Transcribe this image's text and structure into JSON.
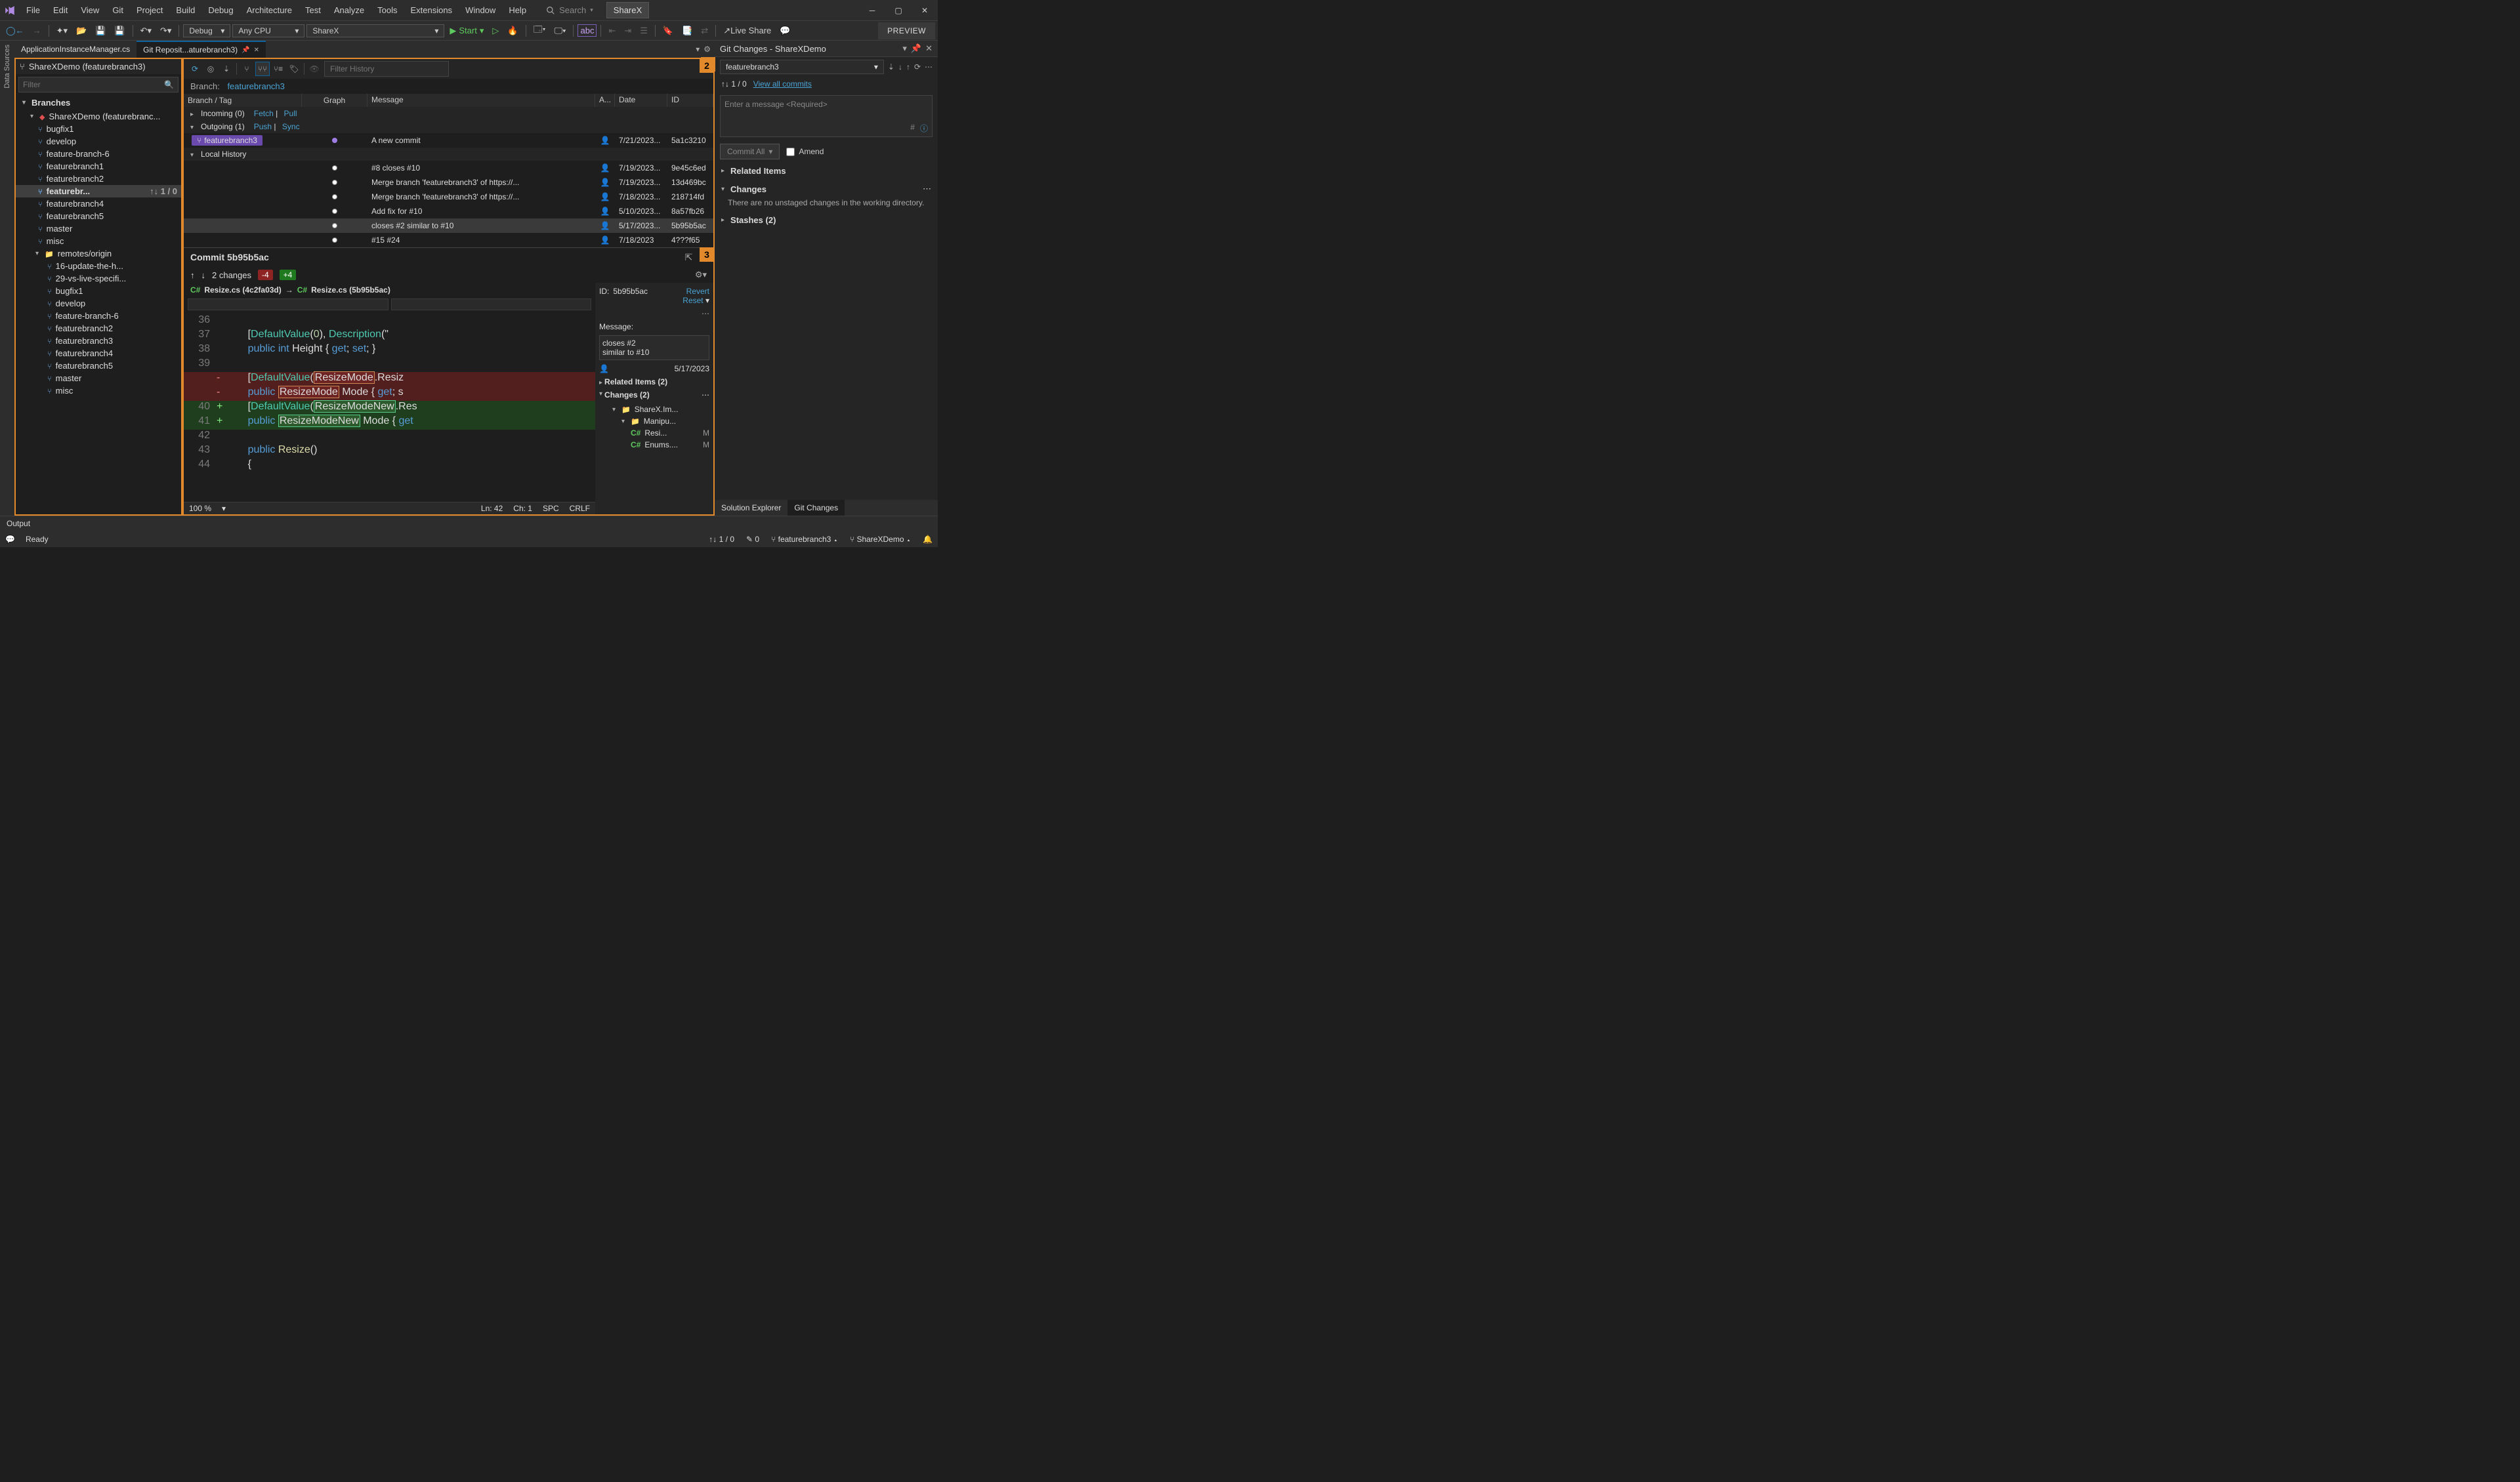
{
  "menu": [
    "File",
    "Edit",
    "View",
    "Git",
    "Project",
    "Build",
    "Debug",
    "Architecture",
    "Test",
    "Analyze",
    "Tools",
    "Extensions",
    "Window",
    "Help"
  ],
  "search_placeholder": "Search",
  "project_name": "ShareX",
  "toolbar": {
    "config": "Debug",
    "platform": "Any CPU",
    "target": "ShareX",
    "start": "Start",
    "live_share": "Live Share",
    "preview": "PREVIEW"
  },
  "tabs": [
    {
      "title": "ApplicationInstanceManager.cs",
      "active": false
    },
    {
      "title": "Git Reposit...aturebranch3)",
      "active": true
    }
  ],
  "repo_panel": {
    "title": "ShareXDemo (featurebranch3)",
    "filter_placeholder": "Filter",
    "branches_label": "Branches",
    "root": "ShareXDemo (featurebranc...",
    "local": [
      "bugfix1",
      "develop",
      "feature-branch-6",
      "featurebranch1",
      "featurebranch2",
      "featurebr...",
      "featurebranch4",
      "featurebranch5",
      "master",
      "misc"
    ],
    "sel_counts": "1 / 0",
    "remotes_label": "remotes/origin",
    "remotes": [
      "16-update-the-h...",
      "29-vs-live-specifi...",
      "bugfix1",
      "develop",
      "feature-branch-6",
      "featurebranch2",
      "featurebranch3",
      "featurebranch4",
      "featurebranch5",
      "master",
      "misc"
    ]
  },
  "history": {
    "filter_placeholder": "Filter History",
    "branch_label": "Branch:",
    "branch_value": "featurebranch3",
    "cols": [
      "Branch / Tag",
      "Graph",
      "Message",
      "A...",
      "Date",
      "ID"
    ],
    "incoming": "Incoming (0)",
    "incoming_actions": [
      "Fetch",
      "Pull"
    ],
    "outgoing": "Outgoing (1)",
    "outgoing_actions": [
      "Push",
      "Sync"
    ],
    "outgoing_commit": {
      "tag": "featurebranch3",
      "msg": "A new commit",
      "date": "7/21/2023...",
      "id": "5a1c3210"
    },
    "local_history_label": "Local History",
    "rows": [
      {
        "msg": "#8 closes #10",
        "date": "7/19/2023...",
        "id": "9e45c6ed"
      },
      {
        "msg": "Merge branch 'featurebranch3' of https://...",
        "date": "7/19/2023...",
        "id": "13d469bc"
      },
      {
        "msg": "Merge branch 'featurebranch3' of https://...",
        "date": "7/18/2023...",
        "id": "218714fd"
      },
      {
        "msg": "Add fix for #10",
        "date": "5/10/2023...",
        "id": "8a57fb26"
      },
      {
        "msg": "closes #2 similar to #10",
        "date": "5/17/2023...",
        "id": "5b95b5ac",
        "sel": true
      },
      {
        "msg": "#15 #24",
        "date": "7/18/2023",
        "id": "4???f65"
      }
    ]
  },
  "commit": {
    "title": "Commit 5b95b5ac",
    "changes_label": "2 changes",
    "minus": "-4",
    "plus": "+4",
    "file_left": "Resize.cs (4c2fa03d)",
    "file_right": "Resize.cs (5b95b5ac)",
    "zoom": "100 %",
    "ln": "Ln: 42",
    "ch": "Ch: 1",
    "spc": "SPC",
    "crlf": "CRLF",
    "side": {
      "id_label": "ID:",
      "id": "5b95b5ac",
      "revert": "Revert",
      "reset": "Reset",
      "msg_label": "Message:",
      "msg": "closes #2\nsimilar to #10",
      "date": "5/17/2023",
      "related": "Related Items (2)",
      "changes": "Changes (2)",
      "folders": [
        "ShareX.Im...",
        "Manipu..."
      ],
      "files": [
        {
          "name": "Resi...",
          "m": "M"
        },
        {
          "name": "Enums....",
          "m": "M"
        }
      ]
    }
  },
  "git_changes": {
    "title": "Git Changes - ShareXDemo",
    "branch": "featurebranch3",
    "counts": "1 / 0",
    "view_all": "View all commits",
    "msg_placeholder": "Enter a message <Required>",
    "commit_all": "Commit All",
    "amend": "Amend",
    "related": "Related Items",
    "changes_label": "Changes",
    "changes_text": "There are no unstaged changes in the working directory.",
    "stashes": "Stashes (2)",
    "tabs": [
      "Solution Explorer",
      "Git Changes"
    ]
  },
  "output_label": "Output",
  "status": {
    "ready": "Ready",
    "counts": "1 / 0",
    "pending": "0",
    "branch": "featurebranch3",
    "repo": "ShareXDemo"
  }
}
